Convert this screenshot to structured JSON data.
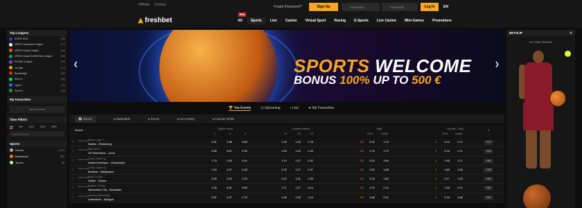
{
  "header": {
    "top_links": [
      "Affiliate",
      "Contact"
    ],
    "logo": "freshbet",
    "forgot": "Forgot Password?",
    "signup": "Sign Up",
    "username_ph": "Username",
    "password_ph": "Password",
    "login": "Log In",
    "lang": "EN",
    "nav": [
      "XD",
      "Sports",
      "Live",
      "Casino",
      "Virtual Sport",
      "Racing",
      "E-Sports",
      "Live Casino",
      "Mini Games",
      "Promotions"
    ],
    "new_badge": "New"
  },
  "sidebar": {
    "top_leagues_title": "Top Leagues",
    "leagues": [
      {
        "name": "EURO 2024",
        "count": "(44)"
      },
      {
        "name": "UEFA Champions League",
        "count": "(17)"
      },
      {
        "name": "UEFA Europa League",
        "count": "(15)"
      },
      {
        "name": "UEFA Europa Conference League",
        "count": "(15)"
      },
      {
        "name": "Premier League",
        "count": "(15)"
      },
      {
        "name": "La Liga",
        "count": "(17)"
      },
      {
        "name": "Bundesliga",
        "count": "(12)"
      },
      {
        "name": "Serie A",
        "count": "(11)"
      },
      {
        "name": "Ligue 1",
        "count": "(11)"
      },
      {
        "name": "Serie A",
        "count": "(16)"
      }
    ],
    "fav_title": "My Favourites",
    "fav_none": "Not Selected",
    "tf_title": "Time Filters",
    "tf_options": [
      "All",
      "6H",
      "12H",
      "24H",
      "48H"
    ],
    "search_ph": "Search Event...",
    "sports_title": "Sports",
    "sports": [
      {
        "name": "Soccer",
        "count": "1424"
      },
      {
        "name": "Basketball",
        "count": "337"
      },
      {
        "name": "Tennis",
        "count": "68"
      }
    ]
  },
  "banner": {
    "line1a": "SPORTS ",
    "line1b": "WELCOME",
    "line2a": "BONUS ",
    "line2b": "100% ",
    "line2c": "UP TO ",
    "line2d": "500 €"
  },
  "event_tabs": [
    "Top Events",
    "Upcoming",
    "Live",
    "My Favourites"
  ],
  "sport_tabs": [
    "Soccer",
    "Basketball",
    "Tennis",
    "Ice Hockey",
    "Counter-Strike"
  ],
  "odds_header": {
    "sport": "Soccer",
    "match_result": "Match result",
    "mr_cols": [
      "1",
      "X",
      "2"
    ],
    "double_chance": "Double chance",
    "dc_cols": [
      "1X",
      "12",
      "X2"
    ],
    "total": "Total",
    "total_cols": [
      "Over",
      "Under"
    ],
    "first_half": "1st half - Total",
    "fh_cols": [
      "Over",
      "Under"
    ]
  },
  "matches": [
    {
      "time": "Today\n21:00",
      "league": "France, Ligue 1",
      "teams": "Nantes - Strasbourg",
      "mr": [
        "2.31",
        "3.36",
        "3.58"
      ],
      "dc": [
        "1.33",
        "1.32",
        "1.78"
      ],
      "total_line": "2.5",
      "total": [
        "2.31",
        "1.70"
      ],
      "fh_line": "1",
      "fh": [
        "2.14",
        "1.71"
      ],
      "more": "+670"
    },
    {
      "time": "Today\n21:00",
      "league": "Italy, Serie A",
      "teams": "US Salernitana - Lecce",
      "mr": [
        "3.36",
        "3.67",
        "2.30"
      ],
      "dc": [
        "1.63",
        "1.32",
        "1.33"
      ],
      "total_line": "2.5",
      "total": [
        "1.70",
        "1.73"
      ],
      "fh_line": "1",
      "fh": [
        "2.16",
        "1.71"
      ],
      "more": "+606"
    },
    {
      "time": "Today\n21:00",
      "league": "Turkey, Super Lig",
      "teams": "Adana Demirspor - Giresunspor",
      "mr": [
        "1.75",
        "3.45",
        "4.91"
      ],
      "dc": [
        "1.19",
        "1.27",
        "2.02"
      ],
      "total_line": "2.5",
      "total": [
        "2.02",
        "1.84"
      ],
      "fh_line": "1",
      "fh": [
        "1.95",
        "1.71"
      ],
      "more": "+560"
    },
    {
      "time": "Today\n21:00",
      "league": "Turkey, Super Lig",
      "teams": "Besiktas - Antalyaspor",
      "mr": [
        "1.84",
        "3.47",
        "4.28"
      ],
      "dc": [
        "1.23",
        "1.27",
        "1.97"
      ],
      "total_line": "2.5",
      "total": [
        "1.92",
        "1.88"
      ],
      "fh_line": "1",
      "fh": [
        "1.86",
        "1.56"
      ],
      "more": "+568"
    },
    {
      "time": "Today\n21:00",
      "league": "Spain, La Liga",
      "teams": "Getafe - Girona",
      "mr": [
        "3.25",
        "3.23",
        "2.23"
      ],
      "dc": [
        "1.67",
        "1.31",
        "1.35"
      ],
      "total_line": "2.5",
      "total": [
        "2.04",
        "1.82"
      ],
      "fh_line": "1",
      "fh": [
        "2.17",
        "1.63"
      ],
      "more": "+563"
    },
    {
      "time": "Today\n21:00",
      "league": "England, FA Cup",
      "teams": "Manchester City - Newcastle",
      "mr": [
        "1.35",
        "6.51",
        "9.53"
      ],
      "dc": [
        "1.71",
        "1.27",
        "3.14"
      ],
      "total_line": "2.5",
      "total": [
        "1.70",
        "2.14"
      ],
      "fh_line": "1",
      "fh": [
        "1.56",
        "2.37"
      ],
      "more": "+651"
    },
    {
      "time": "Today\n21:00",
      "league": "Germany, Bundesliga",
      "teams": "Hoffenheim - Stuttgart",
      "mr": [
        "3.87",
        "4.07",
        "1.79"
      ],
      "dc": [
        "1.96",
        "1.26",
        "1.14"
      ],
      "total_line": "3.5",
      "total": [
        "1.68",
        "2.01"
      ],
      "fh_line": "1",
      "fh": [
        "2.16",
        "1.68"
      ],
      "more": "+604"
    }
  ],
  "betslip": {
    "title": "BETSLIP",
    "none": "No Odds Selected"
  }
}
